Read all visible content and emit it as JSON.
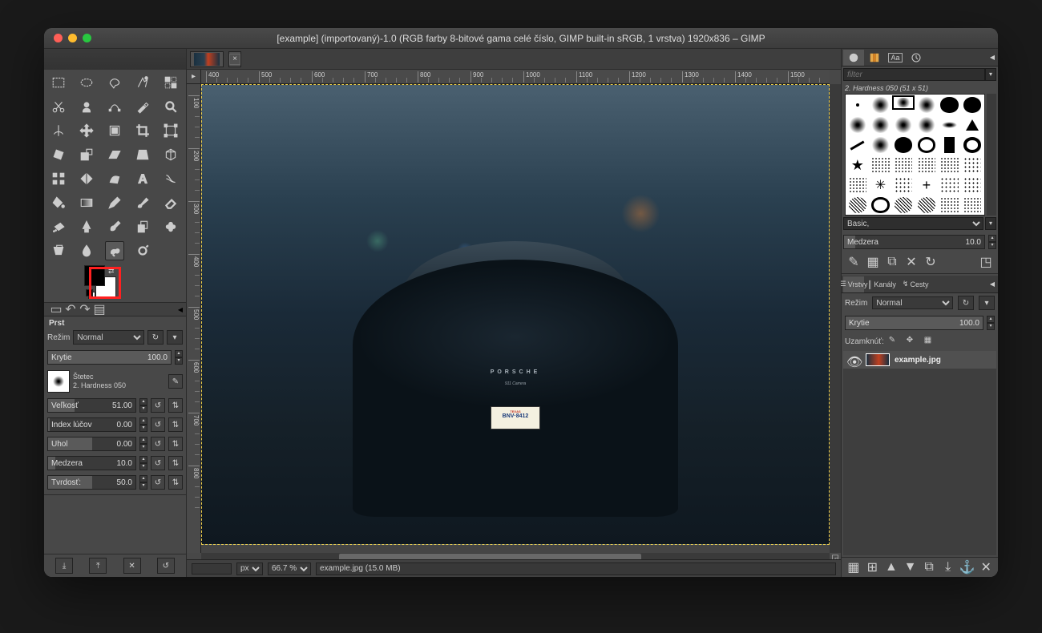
{
  "window": {
    "title": "[example] (importovaný)-1.0 (RGB farby 8-bitové gama celé číslo, GIMP built-in sRGB, 1 vrstva) 1920x836 – GIMP"
  },
  "image_tab": {
    "close_label": "×"
  },
  "tool_options": {
    "title": "Prst",
    "mode_label": "Režim",
    "mode_value": "Normal",
    "opacity_label": "Krytie",
    "opacity_value": "100.0",
    "brush_label": "Štetec",
    "brush_name": "2. Hardness 050",
    "sliders": [
      {
        "label": "Veľkosť",
        "value": "51.00",
        "fill": 30
      },
      {
        "label": "Index lúčov",
        "value": "0.00",
        "fill": 2
      },
      {
        "label": "Uhol",
        "value": "0.00",
        "fill": 50
      },
      {
        "label": "Medzera",
        "value": "10.0",
        "fill": 8
      },
      {
        "label": "Tvrdosť:",
        "value": "50.0",
        "fill": 50
      }
    ]
  },
  "ruler": {
    "h_ticks": [
      "400",
      "500",
      "600",
      "700",
      "800",
      "900",
      "1000",
      "1100",
      "1200",
      "1300",
      "1400",
      "1500"
    ],
    "v_ticks": [
      "100",
      "200",
      "300",
      "400",
      "500",
      "600",
      "700",
      "800"
    ]
  },
  "status": {
    "unit": "px",
    "zoom": "66.7 %",
    "file": "example.jpg (15.0 MB)"
  },
  "car": {
    "brand": "PORSCHE",
    "model": "911 Carrera",
    "plate_state": "TEXAS",
    "plate": "BNV·8412"
  },
  "brushes": {
    "filter_placeholder": "filter",
    "selected_name": "2. Hardness 050 (51 x 51)",
    "preset": "Basic,",
    "spacing_label": "Medzera",
    "spacing_value": "10.0"
  },
  "layers": {
    "tab_layers": "Vrstvy",
    "tab_channels": "Kanály",
    "tab_paths": "Cesty",
    "mode_label": "Režim",
    "mode_value": "Normal",
    "opacity_label": "Krytie",
    "opacity_value": "100.0",
    "lock_label": "Uzamknúť:",
    "item_name": "example.jpg"
  }
}
